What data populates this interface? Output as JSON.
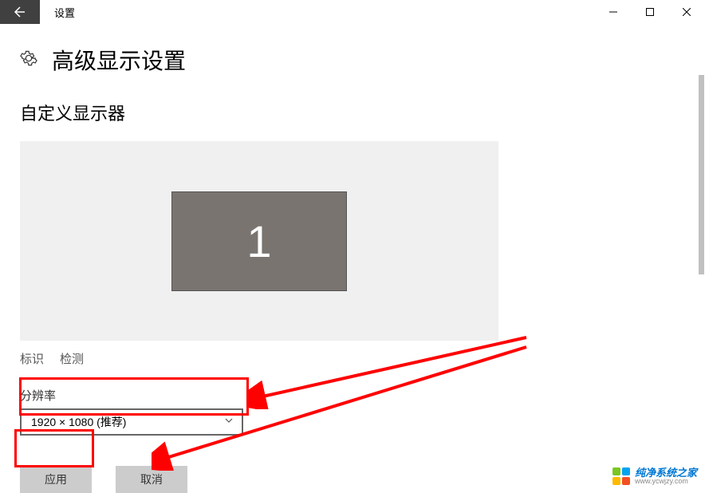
{
  "window": {
    "title": "设置"
  },
  "page": {
    "title": "高级显示设置"
  },
  "section": {
    "customize": "自定义显示器",
    "monitor_number": "1"
  },
  "links": {
    "identify": "标识",
    "detect": "检测"
  },
  "resolution": {
    "label": "分辨率",
    "selected": "1920 × 1080 (推荐)"
  },
  "buttons": {
    "apply": "应用",
    "cancel": "取消"
  },
  "watermark": {
    "main": "纯净系统之家",
    "sub": "www.ycwjzy.com"
  }
}
